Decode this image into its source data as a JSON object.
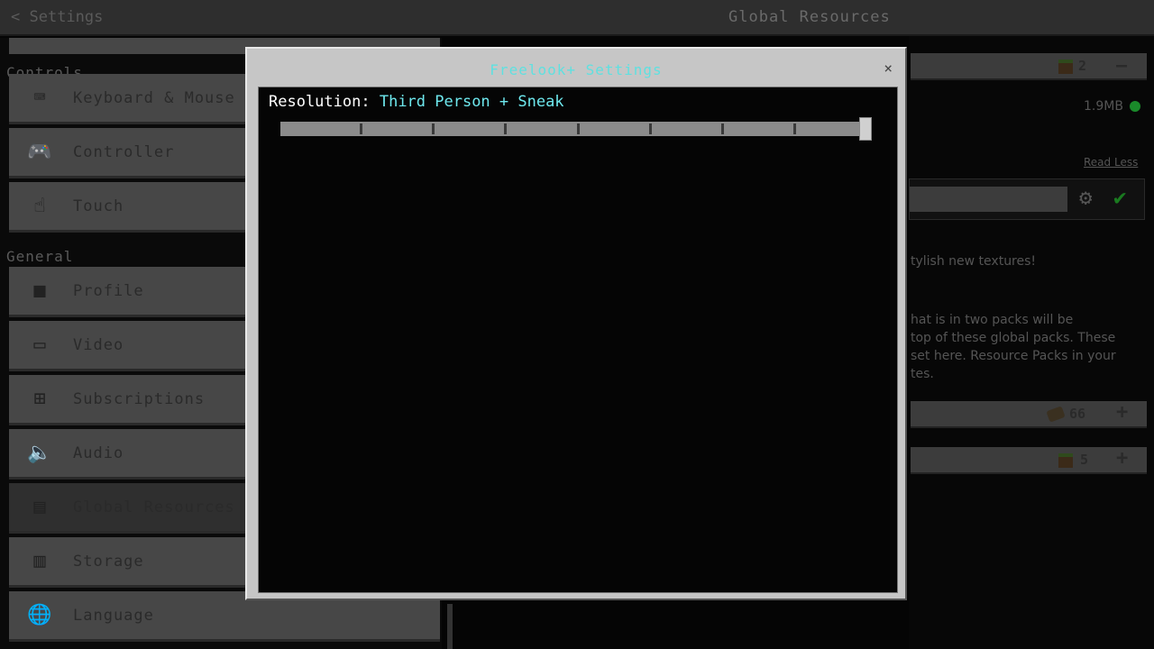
{
  "header": {
    "back_label": "Settings",
    "title": "Global Resources"
  },
  "sidebar": {
    "sections": [
      {
        "label": "Controls"
      },
      {
        "label": "General"
      }
    ],
    "items": [
      {
        "label": "Keyboard & Mouse",
        "icon": "keyboard-mouse-icon"
      },
      {
        "label": "Controller",
        "icon": "controller-icon"
      },
      {
        "label": "Touch",
        "icon": "touch-icon"
      },
      {
        "label": "Profile",
        "icon": "profile-icon"
      },
      {
        "label": "Video",
        "icon": "monitor-icon"
      },
      {
        "label": "Subscriptions",
        "icon": "subscriptions-icon"
      },
      {
        "label": "Audio",
        "icon": "speaker-icon"
      },
      {
        "label": "Global Resources",
        "icon": "global-resources-icon",
        "selected": true
      },
      {
        "label": "Storage",
        "icon": "storage-icon"
      },
      {
        "label": "Language",
        "icon": "language-icon"
      }
    ]
  },
  "right": {
    "active_count": "2",
    "size": "1.9MB",
    "read_less": "Read Less",
    "desc1": "tylish new textures!",
    "desc2": [
      "hat is in two packs will be",
      "top of these global packs. These",
      "set here. Resource Packs in your",
      "tes."
    ],
    "pack_rows": [
      {
        "count": "66",
        "icon": "book-icon"
      },
      {
        "count": "5",
        "icon": "grass-block-icon"
      }
    ]
  },
  "dialog": {
    "title": "Freelook+ Settings",
    "close": "×",
    "setting_label": "Resolution:",
    "setting_value": "Third Person + Sneak",
    "slider": {
      "steps": 8,
      "value": 8
    }
  },
  "colors": {
    "accent": "#5fe0e0",
    "value_text": "#6ee8ee",
    "status_green": "#1a8a2a"
  }
}
